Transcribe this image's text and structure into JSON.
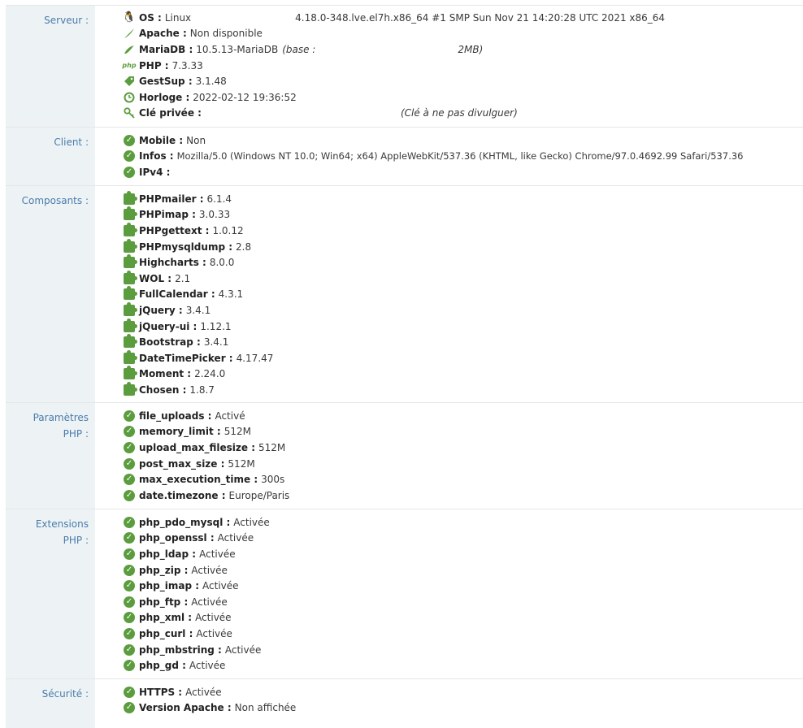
{
  "serveur": {
    "label": "Serveur :",
    "items": [
      {
        "icon": "linux-icon",
        "name": "OS :",
        "value": "Linux",
        "extra": "4.18.0-348.lve.el7h.x86_64 #1 SMP Sun Nov 21 14:20:28 UTC 2021 x86_64"
      },
      {
        "icon": "feather-icon",
        "name": "Apache :",
        "value": "Non disponible"
      },
      {
        "icon": "seal-icon",
        "name": "MariaDB :",
        "value": "10.5.13-MariaDB",
        "extra": "(base :",
        "extra2": "2MB)"
      },
      {
        "icon": "php-icon",
        "name": "PHP :",
        "value": "7.3.33"
      },
      {
        "icon": "tag-icon",
        "name": "GestSup :",
        "value": "3.1.48"
      },
      {
        "icon": "clock-icon",
        "name": "Horloge :",
        "value": "2022-02-12 19:36:52"
      },
      {
        "icon": "key-icon",
        "name": "Clé privée :",
        "value": "",
        "extra": "(Clé à ne pas divulguer)"
      }
    ]
  },
  "client": {
    "label": "Client :",
    "items": [
      {
        "name": "Mobile :",
        "value": "Non"
      },
      {
        "name": "Infos :",
        "value": "Mozilla/5.0 (Windows NT 10.0; Win64; x64) AppleWebKit/537.36 (KHTML, like Gecko) Chrome/97.0.4692.99 Safari/537.36"
      },
      {
        "name": "IPv4 :",
        "value": ""
      }
    ]
  },
  "composants": {
    "label": "Composants :",
    "items": [
      {
        "name": "PHPmailer :",
        "value": "6.1.4"
      },
      {
        "name": "PHPimap :",
        "value": "3.0.33"
      },
      {
        "name": "PHPgettext :",
        "value": "1.0.12"
      },
      {
        "name": "PHPmysqldump :",
        "value": "2.8"
      },
      {
        "name": "Highcharts :",
        "value": "8.0.0"
      },
      {
        "name": "WOL :",
        "value": "2.1"
      },
      {
        "name": "FullCalendar :",
        "value": "4.3.1"
      },
      {
        "name": "jQuery :",
        "value": "3.4.1"
      },
      {
        "name": "jQuery-ui :",
        "value": "1.12.1"
      },
      {
        "name": "Bootstrap :",
        "value": "3.4.1"
      },
      {
        "name": "DateTimePicker :",
        "value": "4.17.47"
      },
      {
        "name": "Moment :",
        "value": "2.24.0"
      },
      {
        "name": "Chosen :",
        "value": "1.8.7"
      }
    ]
  },
  "params_php": {
    "label1": "Paramètres",
    "label2": "PHP :",
    "items": [
      {
        "name": "file_uploads :",
        "value": "Activé"
      },
      {
        "name": "memory_limit :",
        "value": "512M"
      },
      {
        "name": "upload_max_filesize :",
        "value": "512M"
      },
      {
        "name": "post_max_size :",
        "value": "512M"
      },
      {
        "name": "max_execution_time :",
        "value": "300s"
      },
      {
        "name": "date.timezone :",
        "value": "Europe/Paris"
      }
    ]
  },
  "extensions_php": {
    "label1": "Extensions",
    "label2": "PHP :",
    "items": [
      {
        "name": "php_pdo_mysql :",
        "value": "Activée"
      },
      {
        "name": "php_openssl :",
        "value": "Activée"
      },
      {
        "name": "php_ldap :",
        "value": "Activée"
      },
      {
        "name": "php_zip :",
        "value": "Activée"
      },
      {
        "name": "php_imap :",
        "value": "Activée"
      },
      {
        "name": "php_ftp :",
        "value": "Activée"
      },
      {
        "name": "php_xml :",
        "value": "Activée"
      },
      {
        "name": "php_curl :",
        "value": "Activée"
      },
      {
        "name": "php_mbstring :",
        "value": "Activée"
      },
      {
        "name": "php_gd :",
        "value": "Activée"
      }
    ]
  },
  "securite": {
    "label": "Sécurité :",
    "items": [
      {
        "name": "HTTPS :",
        "value": "Activée"
      },
      {
        "name": "Version Apache :",
        "value": "Non affichée"
      }
    ]
  }
}
